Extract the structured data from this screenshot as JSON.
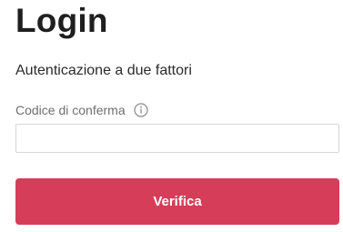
{
  "page": {
    "title": "Login",
    "subtitle": "Autenticazione a due fattori"
  },
  "form": {
    "code_label": "Codice di conferma",
    "code_value": "",
    "code_placeholder": "",
    "info_icon": "info-circle-icon",
    "submit_label": "Verifica"
  },
  "colors": {
    "accent": "#d63d58",
    "text": "#1f1f1f",
    "muted": "#6f6f6f",
    "border": "#d6d6d6"
  }
}
